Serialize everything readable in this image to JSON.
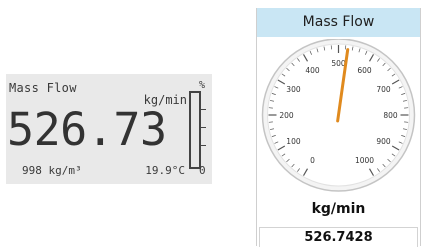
{
  "lcd": {
    "title": "Mass Flow",
    "unit": "kg/min",
    "value": "526.73",
    "density": "998 kg/m³",
    "temperature": "19.9°C",
    "bar_top_label": "%",
    "bar_bottom_label": "0"
  },
  "gauge": {
    "title": "Mass Flow",
    "unit": "kg/min",
    "readout": "526.7428",
    "scale_min": 0,
    "scale_max": 1000,
    "scale_labels": [
      "0",
      "100",
      "200",
      "300",
      "400",
      "500",
      "600",
      "700",
      "800",
      "900",
      "1000"
    ],
    "needle_value": 526.7428,
    "needle_color": "#e08a1e",
    "title_bg_color": "#c9e6f4"
  }
}
